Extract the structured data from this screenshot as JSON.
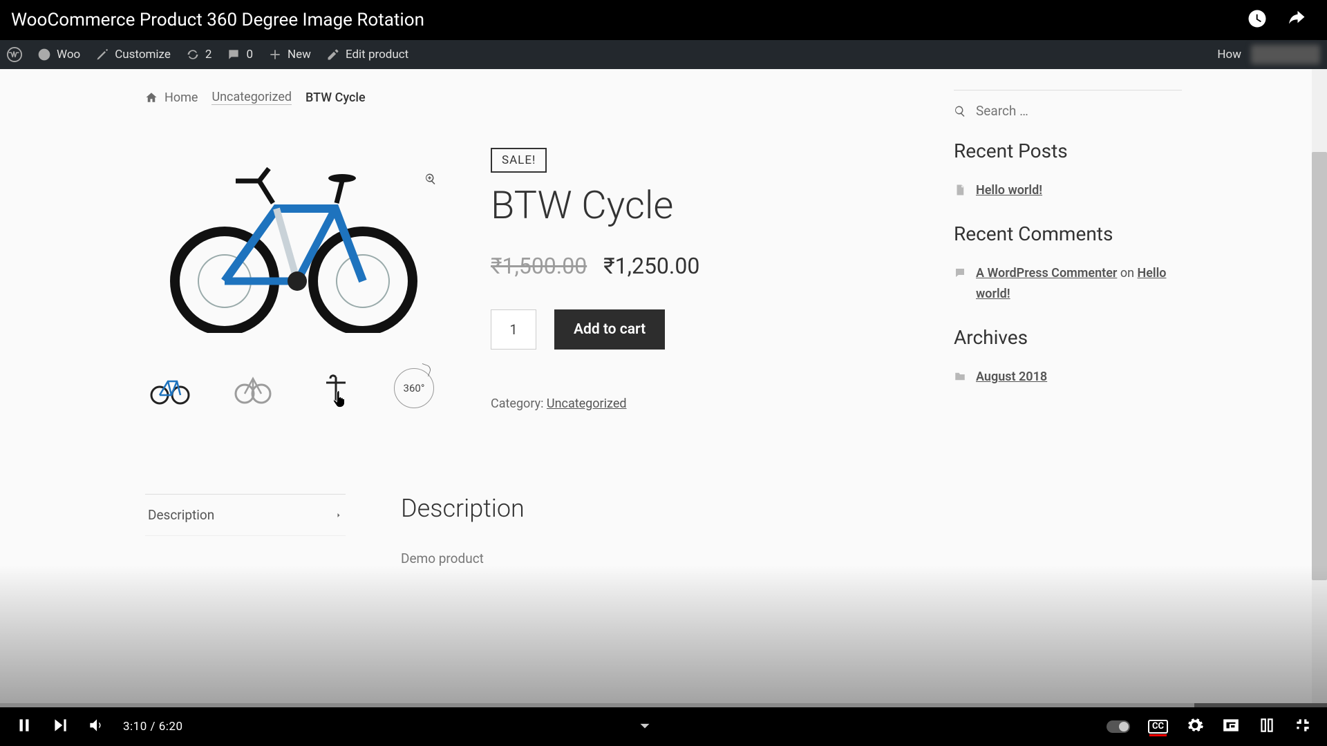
{
  "video": {
    "title": "WooCommerce Product 360 Degree Image Rotation",
    "current_time": "3:10",
    "duration": "6:20",
    "progress_pct": 50,
    "loaded_pct": 90,
    "cc_label": "CC"
  },
  "wp_bar": {
    "site": "Woo",
    "customize": "Customize",
    "updates": "2",
    "comments": "0",
    "new": "New",
    "edit": "Edit product",
    "howdy": "How"
  },
  "breadcrumbs": {
    "home": "Home",
    "cat": "Uncategorized",
    "current": "BTW Cycle"
  },
  "product": {
    "sale": "SALE!",
    "title": "BTW Cycle",
    "old_price": "₹1,500.00",
    "price": "₹1,250.00",
    "qty": "1",
    "add_to_cart": "Add to cart",
    "cat_label": "Category: ",
    "cat_link": "Uncategorized",
    "thumb_360": "360°"
  },
  "sidebar": {
    "search_placeholder": "Search …",
    "recent_posts_title": "Recent Posts",
    "recent_post_1": "Hello world!",
    "recent_comments_title": "Recent Comments",
    "commenter": "A WordPress Commenter",
    "on": " on ",
    "comment_post": "Hello world!",
    "archives_title": "Archives",
    "archive_1": "August 2018"
  },
  "tabs": {
    "desc_tab": "Description",
    "desc_heading": "Description",
    "desc_body": "Demo product"
  }
}
